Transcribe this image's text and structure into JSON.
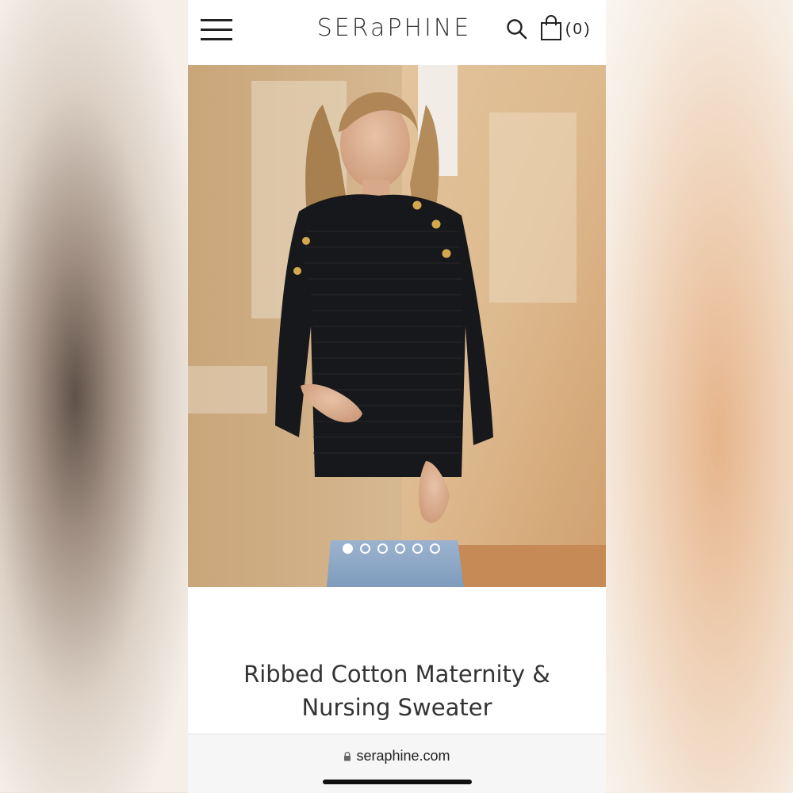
{
  "header": {
    "logo": "SERaPHINE",
    "cart_count": "(0)"
  },
  "gallery": {
    "slides": 6,
    "active_slide": 1
  },
  "product": {
    "title_line1": "Ribbed Cotton Maternity &",
    "title_line2": "Nursing Sweater"
  },
  "browser": {
    "url": "seraphine.com"
  },
  "icons": {
    "menu": "hamburger-menu-icon",
    "search": "search-icon",
    "cart": "shopping-bag-icon",
    "lock": "lock-icon"
  }
}
